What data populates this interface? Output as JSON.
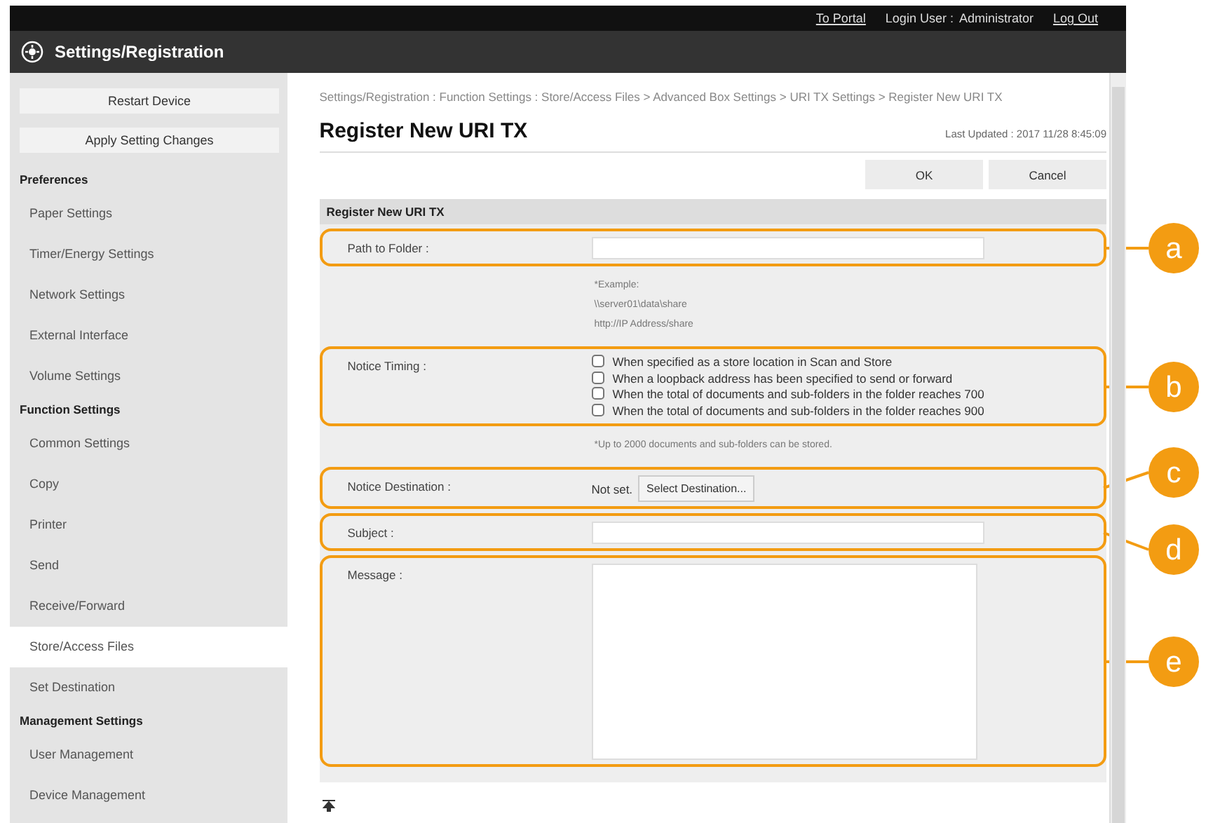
{
  "top_bar": {
    "portal_link": "To Portal",
    "login_label": "Login User :",
    "login_user": "Administrator",
    "logout_link": "Log Out"
  },
  "header": {
    "title": "Settings/Registration"
  },
  "sidebar": {
    "buttons": [
      "Restart Device",
      "Apply Setting Changes"
    ],
    "sections": [
      {
        "title": "Preferences",
        "items": [
          {
            "label": "Paper Settings",
            "selected": false
          },
          {
            "label": "Timer/Energy Settings",
            "selected": false
          },
          {
            "label": "Network Settings",
            "selected": false
          },
          {
            "label": "External Interface",
            "selected": false
          },
          {
            "label": "Volume Settings",
            "selected": false
          }
        ]
      },
      {
        "title": "Function Settings",
        "items": [
          {
            "label": "Common Settings",
            "selected": false
          },
          {
            "label": "Copy",
            "selected": false
          },
          {
            "label": "Printer",
            "selected": false
          },
          {
            "label": "Send",
            "selected": false
          },
          {
            "label": "Receive/Forward",
            "selected": false
          },
          {
            "label": "Store/Access Files",
            "selected": true
          },
          {
            "label": "Set Destination",
            "selected": false
          }
        ]
      },
      {
        "title": "Management Settings",
        "items": [
          {
            "label": "User Management",
            "selected": false
          },
          {
            "label": "Device Management",
            "selected": false
          }
        ]
      }
    ]
  },
  "main": {
    "breadcrumb": "Settings/Registration : Function Settings : Store/Access Files > Advanced Box Settings > URI TX Settings > Register New URI TX",
    "title": "Register New URI TX",
    "last_updated": "Last Updated : 2017 11/28 8:45:09",
    "buttons": [
      "OK",
      "Cancel"
    ],
    "section_title": "Register New URI TX",
    "rows": [
      {
        "kind": "text",
        "label": "Path to Folder :",
        "callout": "a",
        "notes": [
          "*Example:",
          "\\\\server01\\data\\share",
          "http://IP Address/share"
        ]
      },
      {
        "kind": "checkboxes",
        "label": "Notice Timing :",
        "callout": "b",
        "options": [
          {
            "label": "When specified as a store location in Scan and Store",
            "checked": false
          },
          {
            "label": "When a loopback address has been specified to send or forward",
            "checked": false
          },
          {
            "label": "When the total of documents and sub-folders in the folder reaches 700",
            "checked": false
          },
          {
            "label": "When the total of documents and sub-folders in the folder reaches 900",
            "checked": false
          }
        ],
        "notes": [
          "*Up to 2000 documents and sub-folders can be stored."
        ]
      },
      {
        "kind": "destination",
        "label": "Notice Destination :",
        "callout": "c",
        "value": "Not set.",
        "button": "Select Destination..."
      },
      {
        "kind": "text",
        "label": "Subject :",
        "callout": "d"
      },
      {
        "kind": "textarea",
        "label": "Message :",
        "callout": "e"
      }
    ]
  }
}
